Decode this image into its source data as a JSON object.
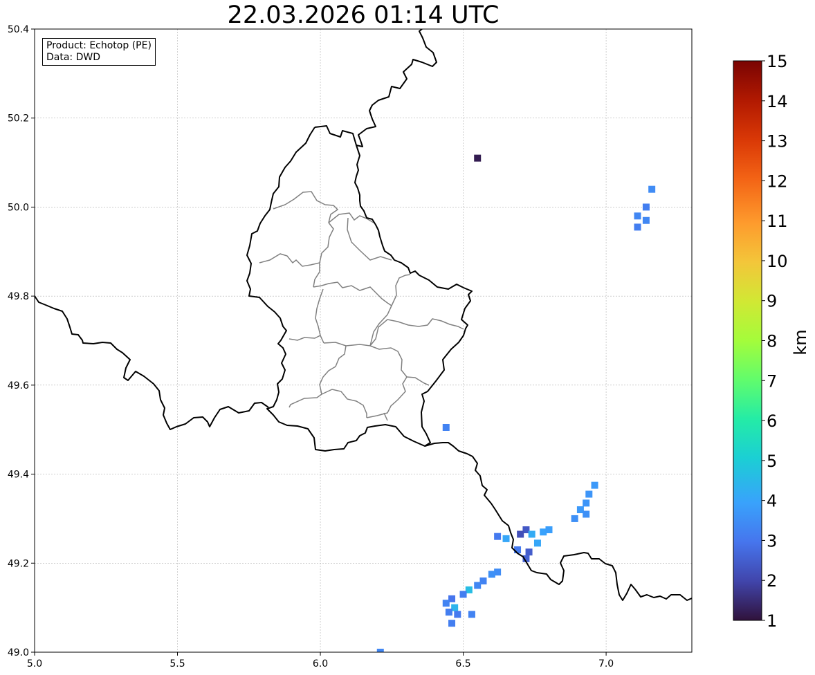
{
  "title": "22.03.2026 01:14 UTC",
  "info": {
    "product_line": "Product: Echotop (PE)",
    "data_line": "Data: DWD"
  },
  "map": {
    "x_ticks": [
      5.0,
      5.5,
      6.0,
      6.5,
      7.0
    ],
    "y_ticks": [
      50.4,
      50.2,
      50.0,
      49.8,
      49.6,
      49.4,
      49.2,
      49.0
    ],
    "x_tick_labels": [
      "5.0",
      "5.5",
      "6.0",
      "6.5",
      "7.0"
    ],
    "y_tick_labels": [
      "50.4",
      "50.2",
      "50.0",
      "49.8",
      "49.6",
      "49.4",
      "49.2",
      "49.0"
    ],
    "lon_range": [
      5.0,
      7.3
    ],
    "lat_range": [
      49.0,
      50.4
    ],
    "grid": true,
    "border_color": "#000000",
    "district_color": "#808080"
  },
  "colorbar": {
    "label": "km",
    "min": 1,
    "max": 15,
    "ticks": [
      1,
      2,
      3,
      4,
      5,
      6,
      7,
      8,
      9,
      10,
      11,
      12,
      13,
      14,
      15
    ],
    "tick_labels": [
      "1",
      "2",
      "3",
      "4",
      "5",
      "6",
      "7",
      "8",
      "9",
      "10",
      "11",
      "12",
      "13",
      "14",
      "15"
    ],
    "colormap": "turbo"
  },
  "echo_cells": [
    {
      "lon": 6.55,
      "lat": 50.11,
      "value": 1.2
    },
    {
      "lon": 7.16,
      "lat": 50.04,
      "value": 3.5
    },
    {
      "lon": 7.14,
      "lat": 50.0,
      "value": 3.2
    },
    {
      "lon": 7.11,
      "lat": 49.98,
      "value": 3.4
    },
    {
      "lon": 7.14,
      "lat": 49.97,
      "value": 3.4
    },
    {
      "lon": 7.11,
      "lat": 49.955,
      "value": 3.2
    },
    {
      "lon": 6.44,
      "lat": 49.505,
      "value": 3.3
    },
    {
      "lon": 6.96,
      "lat": 49.375,
      "value": 3.8
    },
    {
      "lon": 6.94,
      "lat": 49.355,
      "value": 3.7
    },
    {
      "lon": 6.93,
      "lat": 49.335,
      "value": 3.7
    },
    {
      "lon": 6.91,
      "lat": 49.32,
      "value": 3.8
    },
    {
      "lon": 6.93,
      "lat": 49.31,
      "value": 3.6
    },
    {
      "lon": 6.89,
      "lat": 49.3,
      "value": 3.6
    },
    {
      "lon": 6.62,
      "lat": 49.26,
      "value": 3.1
    },
    {
      "lon": 6.65,
      "lat": 49.255,
      "value": 4.1
    },
    {
      "lon": 6.72,
      "lat": 49.275,
      "value": 2.4
    },
    {
      "lon": 6.7,
      "lat": 49.265,
      "value": 2.2
    },
    {
      "lon": 6.74,
      "lat": 49.265,
      "value": 4.2
    },
    {
      "lon": 6.78,
      "lat": 49.27,
      "value": 4.0
    },
    {
      "lon": 6.8,
      "lat": 49.275,
      "value": 3.9
    },
    {
      "lon": 6.76,
      "lat": 49.245,
      "value": 4.1
    },
    {
      "lon": 6.69,
      "lat": 49.23,
      "value": 3.1
    },
    {
      "lon": 6.73,
      "lat": 49.225,
      "value": 2.5
    },
    {
      "lon": 6.72,
      "lat": 49.21,
      "value": 2.6
    },
    {
      "lon": 6.62,
      "lat": 49.18,
      "value": 3.5
    },
    {
      "lon": 6.6,
      "lat": 49.175,
      "value": 3.6
    },
    {
      "lon": 6.57,
      "lat": 49.16,
      "value": 3.3
    },
    {
      "lon": 6.55,
      "lat": 49.15,
      "value": 3.4
    },
    {
      "lon": 6.52,
      "lat": 49.14,
      "value": 4.6
    },
    {
      "lon": 6.5,
      "lat": 49.13,
      "value": 3.2
    },
    {
      "lon": 6.46,
      "lat": 49.12,
      "value": 3.0
    },
    {
      "lon": 6.44,
      "lat": 49.11,
      "value": 3.3
    },
    {
      "lon": 6.47,
      "lat": 49.1,
      "value": 4.4
    },
    {
      "lon": 6.45,
      "lat": 49.09,
      "value": 3.2
    },
    {
      "lon": 6.48,
      "lat": 49.085,
      "value": 3.1
    },
    {
      "lon": 6.53,
      "lat": 49.085,
      "value": 3.3
    },
    {
      "lon": 6.46,
      "lat": 49.065,
      "value": 3.2
    },
    {
      "lon": 6.21,
      "lat": 49.0,
      "value": 3.4
    }
  ]
}
